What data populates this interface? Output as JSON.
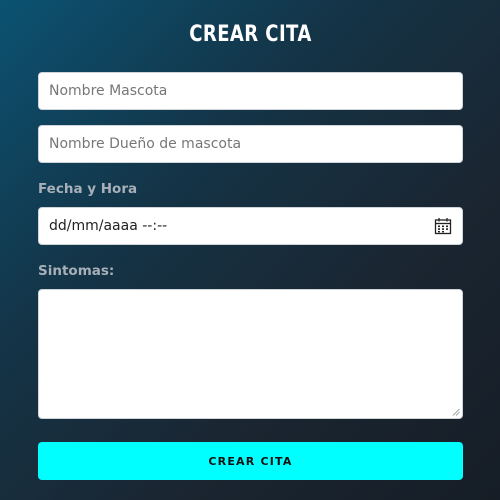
{
  "form": {
    "title": "CREAR CITA",
    "pet_name": {
      "placeholder": "Nombre Mascota",
      "value": ""
    },
    "owner_name": {
      "placeholder": "Nombre Dueño de mascota",
      "value": ""
    },
    "datetime_label": "Fecha y Hora",
    "datetime": {
      "display": "dd/mm/aaaa --:--",
      "icon": "calendar-icon"
    },
    "symptoms_label": "Sintomas:",
    "symptoms": {
      "value": ""
    },
    "submit_label": "CREAR CITA"
  },
  "colors": {
    "background_start": "#0b5272",
    "background_end": "#161d26",
    "button": "#00ffff",
    "label": "#a7b0b8",
    "title": "#ffffff"
  }
}
